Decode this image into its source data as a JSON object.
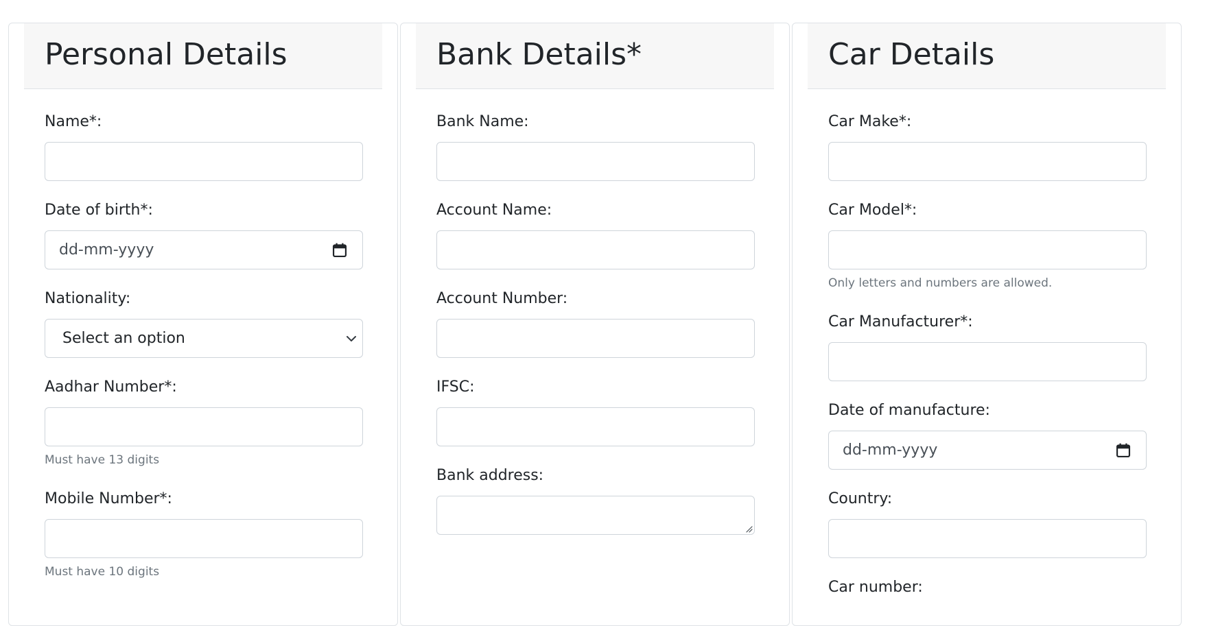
{
  "personal": {
    "title": "Personal Details",
    "name_label": "Name*:",
    "dob_label": "Date of birth*:",
    "dob_placeholder": "dd-mm-yyyy",
    "nationality_label": "Nationality:",
    "nationality_value": "Select an option",
    "aadhar_label": "Aadhar Number*:",
    "aadhar_help": "Must have 13 digits",
    "mobile_label": "Mobile Number*:",
    "mobile_help": "Must have 10 digits"
  },
  "bank": {
    "title": "Bank Details*",
    "bank_name_label": "Bank Name:",
    "account_name_label": "Account Name:",
    "account_number_label": "Account Number:",
    "ifsc_label": "IFSC:",
    "address_label": "Bank address:"
  },
  "car": {
    "title": "Car Details",
    "make_label": "Car Make*:",
    "model_label": "Car Model*:",
    "model_help": "Only letters and numbers are allowed.",
    "manufacturer_label": "Car Manufacturer*:",
    "dom_label": "Date of manufacture:",
    "dom_placeholder": "dd-mm-yyyy",
    "country_label": "Country:",
    "number_label": "Car number:"
  }
}
